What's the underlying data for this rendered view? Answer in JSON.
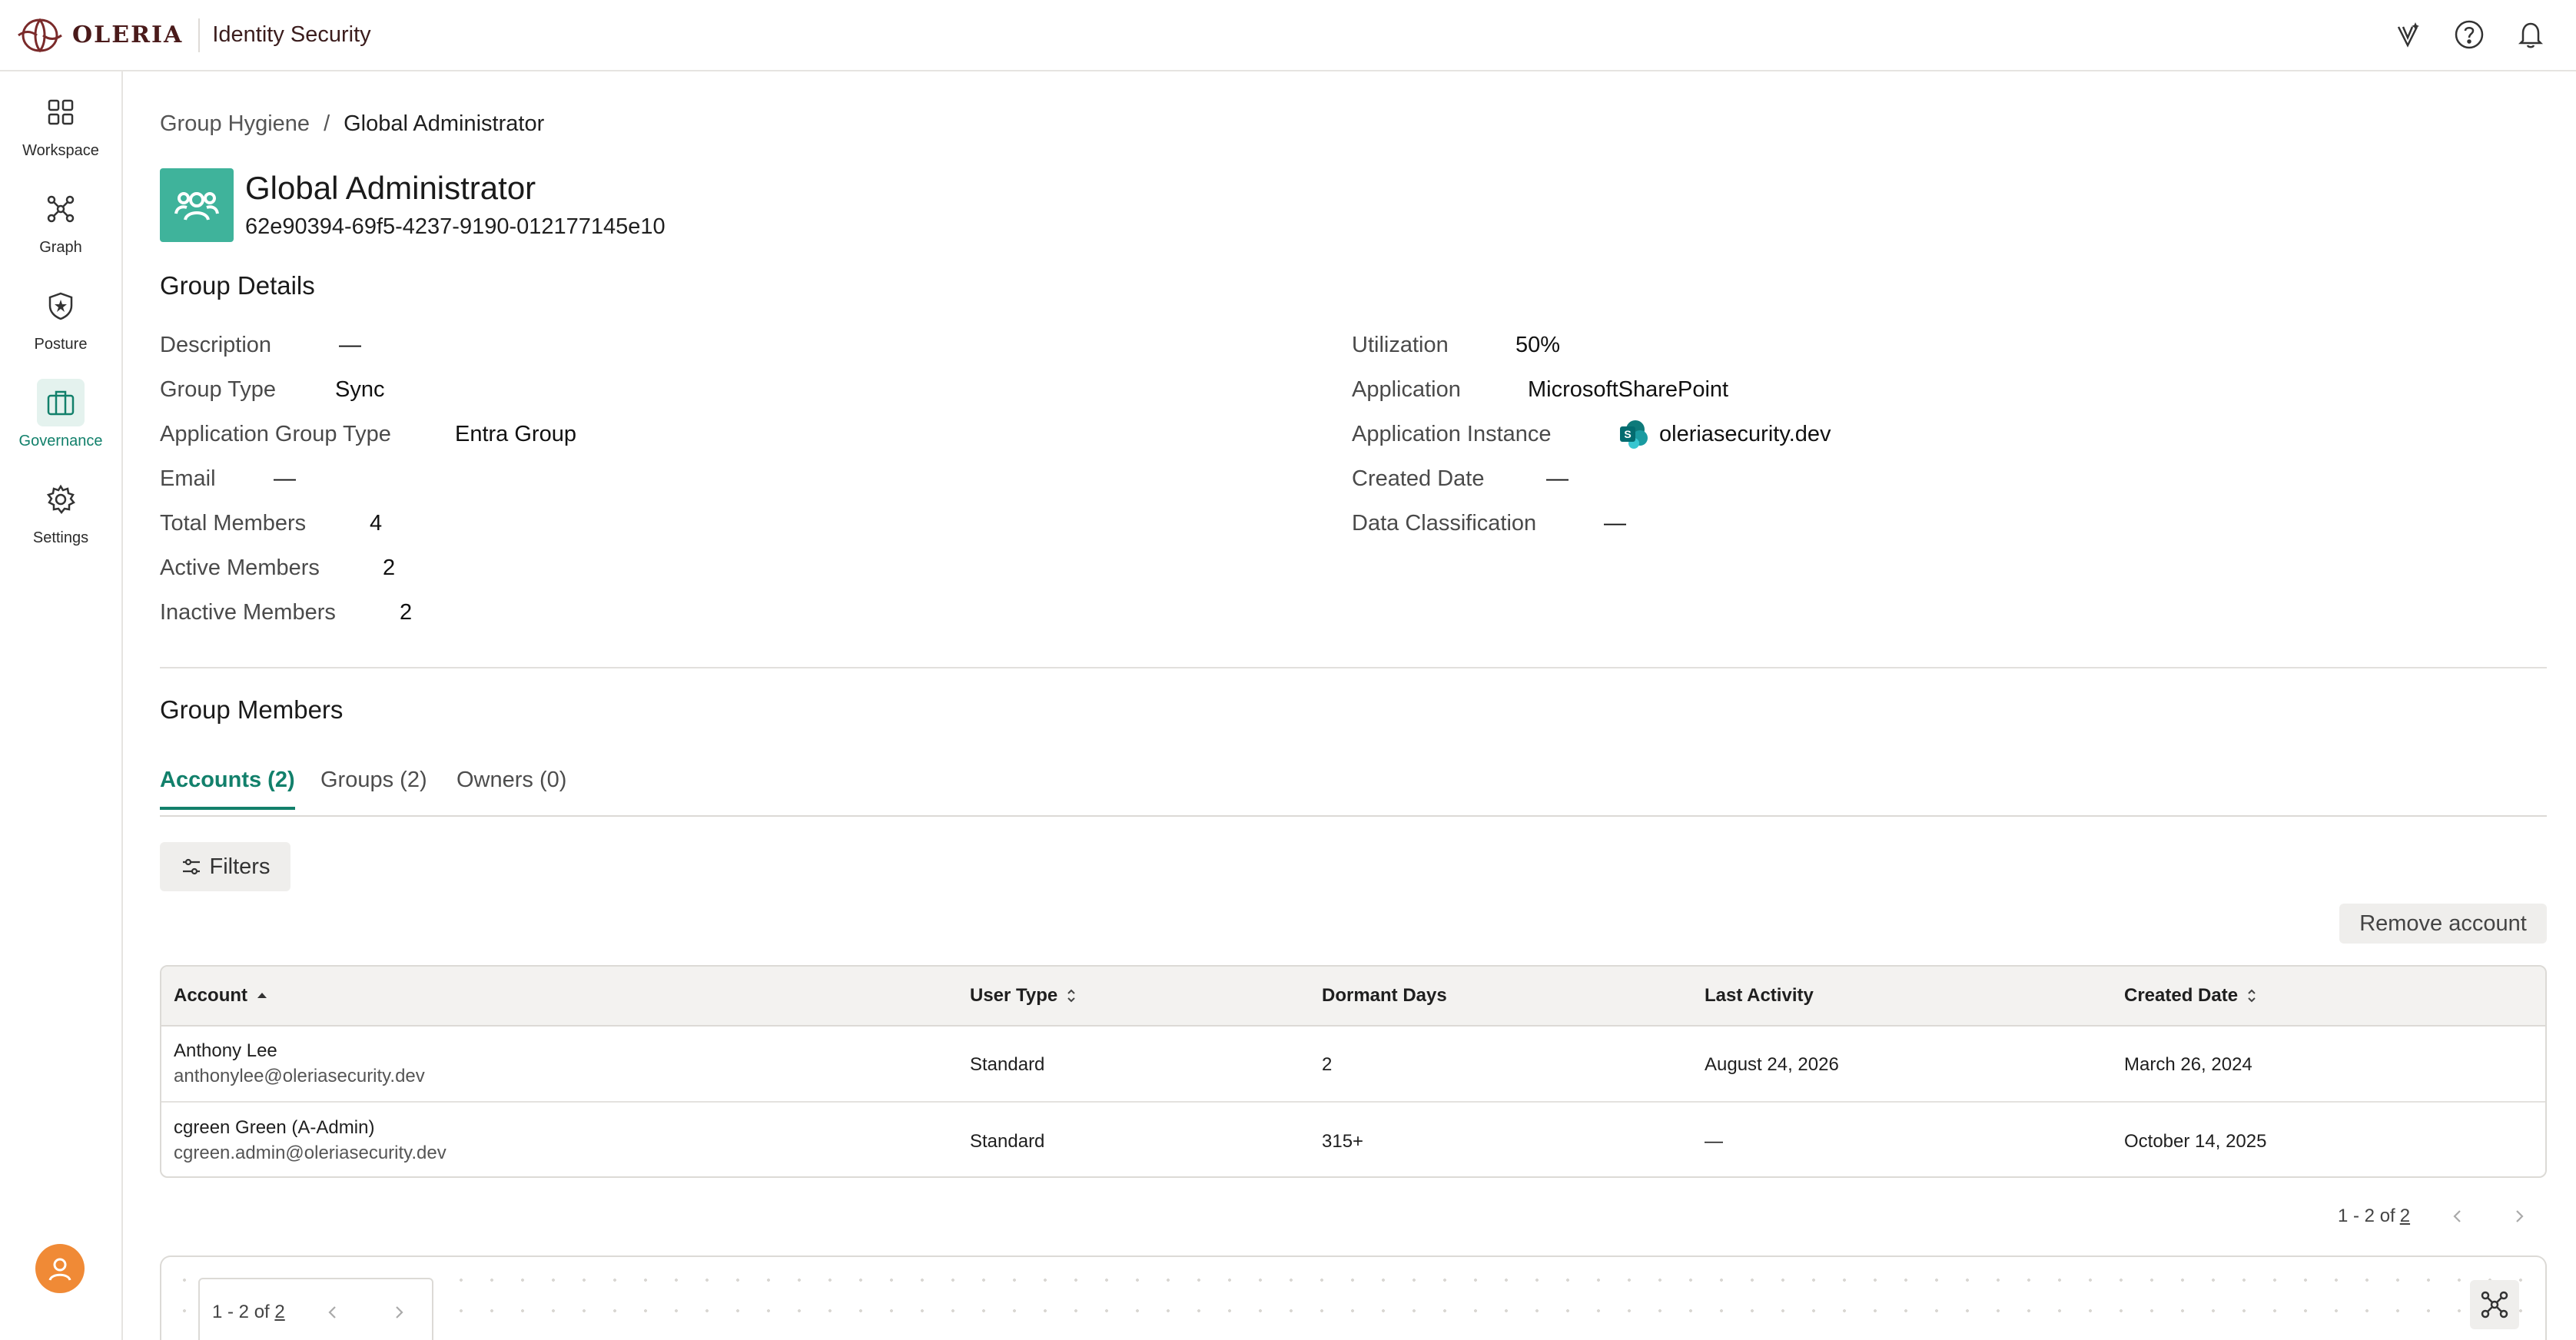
{
  "app": {
    "brand_name": "OLERIA",
    "product": "Identity Security"
  },
  "sidebar": {
    "items": [
      {
        "label": "Workspace",
        "icon": "grid-icon"
      },
      {
        "label": "Graph",
        "icon": "graph-icon"
      },
      {
        "label": "Posture",
        "icon": "shield-icon"
      },
      {
        "label": "Governance",
        "icon": "briefcase-icon",
        "active": true
      },
      {
        "label": "Settings",
        "icon": "gear-icon"
      }
    ]
  },
  "breadcrumb": {
    "parent": "Group Hygiene",
    "separator": "/",
    "current": "Global Administrator"
  },
  "group": {
    "name": "Global Administrator",
    "id": "62e90394-69f5-4237-9190-012177145e10"
  },
  "details": {
    "title": "Group Details",
    "left": [
      {
        "label": "Description",
        "value": "—"
      },
      {
        "label": "Group Type",
        "value": "Sync"
      },
      {
        "label": "Application Group Type",
        "value": "Entra Group"
      },
      {
        "label": "Email",
        "value": "—"
      },
      {
        "label": "Total Members",
        "value": "4"
      },
      {
        "label": "Active Members",
        "value": "2"
      },
      {
        "label": "Inactive Members",
        "value": "2"
      }
    ],
    "right": [
      {
        "label": "Utilization",
        "value": "50%"
      },
      {
        "label": "Application",
        "value": "MicrosoftSharePoint"
      },
      {
        "label": "Application Instance",
        "value": "oleriasecurity.dev"
      },
      {
        "label": "Created Date",
        "value": "—"
      },
      {
        "label": "Data Classification",
        "value": "—"
      }
    ]
  },
  "members": {
    "title": "Group Members",
    "tabs": [
      {
        "label": "Accounts (2)",
        "active": true
      },
      {
        "label": "Groups (2)"
      },
      {
        "label": "Owners (0)"
      }
    ],
    "filters_label": "Filters",
    "remove_label": "Remove account",
    "columns": [
      "Account",
      "User Type",
      "Dormant Days",
      "Last Activity",
      "Created Date"
    ],
    "rows": [
      {
        "name": "Anthony Lee",
        "email": "anthonylee@oleriasecurity.dev",
        "user_type": "Standard",
        "dormant_days": "2",
        "last_activity": "August 24, 2026",
        "created_date": "March 26, 2024"
      },
      {
        "name": "cgreen Green (A-Admin)",
        "email": "cgreen.admin@oleriasecurity.dev",
        "user_type": "Standard",
        "dormant_days": "315+",
        "last_activity": "—",
        "created_date": "October 14, 2025"
      }
    ],
    "pager": {
      "range": "1 - 2 of",
      "total": "2"
    },
    "mini_pager": {
      "range": "1 - 2 of",
      "total": "2"
    }
  },
  "colors": {
    "accent": "#12806b",
    "group_icon_bg": "#3fb39b",
    "avatar_bg": "#f08a36",
    "brand": "#4a1a1a"
  }
}
